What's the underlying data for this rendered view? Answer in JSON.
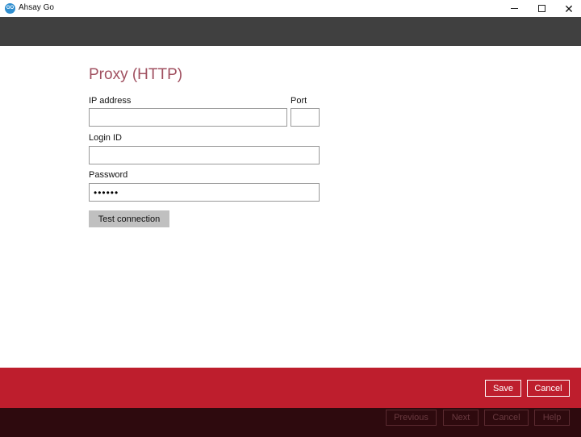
{
  "window": {
    "title": "Ahsay Go",
    "logo_text": "GO",
    "close_glyph": "✕"
  },
  "form": {
    "title": "Proxy (HTTP)",
    "ip_address": {
      "label": "IP address",
      "value": ""
    },
    "port": {
      "label": "Port",
      "value": ""
    },
    "login_id": {
      "label": "Login ID",
      "value": ""
    },
    "password": {
      "label": "Password",
      "value": "••••••"
    },
    "test_connection_label": "Test connection"
  },
  "action_bar": {
    "save_label": "Save",
    "cancel_label": "Cancel"
  },
  "wizard_bar": {
    "previous_label": "Previous",
    "next_label": "Next",
    "cancel_label": "Cancel",
    "help_label": "Help"
  },
  "colors": {
    "title_accent": "#a05060",
    "action_bar": "#be1e2d",
    "header_band": "#404040",
    "wizard_bar": "#2e0a0e"
  }
}
